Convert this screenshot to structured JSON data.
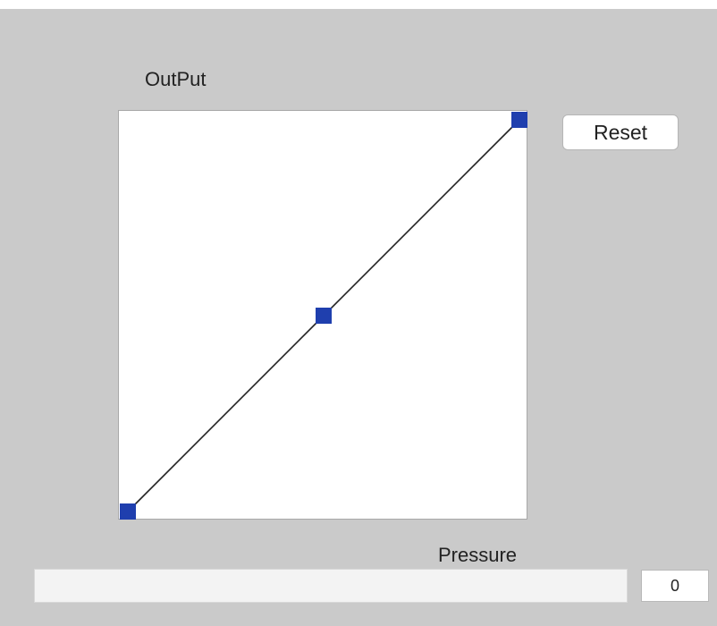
{
  "curve": {
    "title": "OutPut",
    "line_color": "#222222",
    "point_color": "#1f3fae",
    "points": [
      {
        "x": 0,
        "y": 0
      },
      {
        "x": 0.5,
        "y": 0.5
      },
      {
        "x": 1,
        "y": 1
      }
    ]
  },
  "reset_button": {
    "label": "Reset"
  },
  "pressure": {
    "label": "Pressure",
    "value": "0",
    "level": 0
  }
}
